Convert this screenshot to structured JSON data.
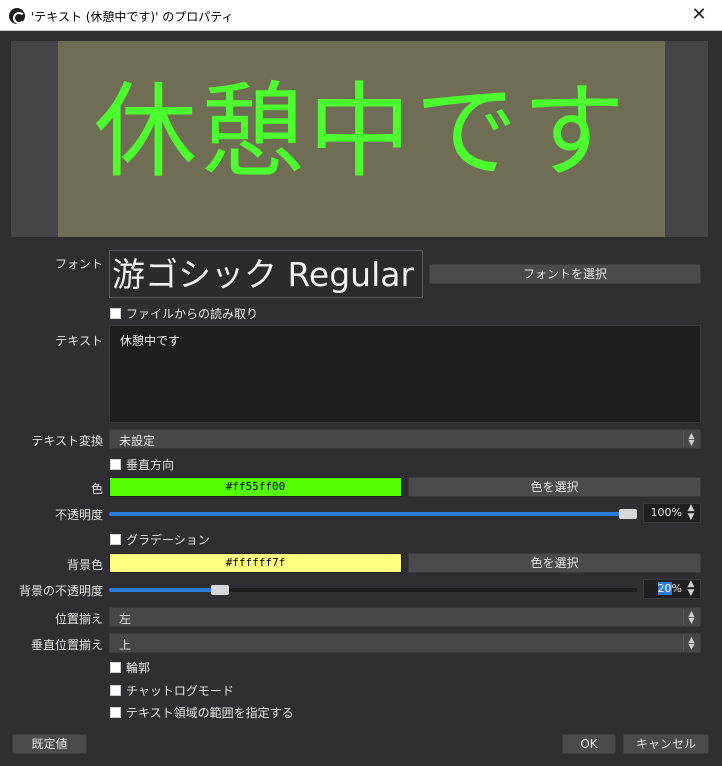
{
  "window": {
    "title": "'テキスト (休憩中です)' のプロパティ",
    "icon": "obs-logo-icon",
    "close_icon": "close-icon"
  },
  "preview": {
    "text": "休憩中です",
    "text_color": "#4cff2e",
    "background_color": "#6f6e54"
  },
  "form": {
    "font": {
      "label": "フォント",
      "value": "游ゴシック Regular",
      "button": "フォントを選択"
    },
    "read_from_file": {
      "label": "ファイルからの読み取り",
      "checked": false
    },
    "text": {
      "label": "テキスト",
      "value": "休憩中です"
    },
    "transform": {
      "label": "テキスト変換",
      "value": "未設定"
    },
    "vertical": {
      "label": "垂直方向",
      "checked": false
    },
    "color": {
      "label": "色",
      "value": "#ff55ff00",
      "swatch_color": "#55ff00",
      "button": "色を選択"
    },
    "opacity": {
      "label": "不透明度",
      "value": "100%",
      "level": 1.0
    },
    "gradient": {
      "label": "グラデーション",
      "checked": false
    },
    "bg_color": {
      "label": "背景色",
      "value": "#ffffff7f",
      "swatch_color": "#ffff7f",
      "button": "色を選択"
    },
    "bg_opacity": {
      "label": "背景の不透明度",
      "value_selected": "20",
      "value_suffix": "%",
      "level": 0.2
    },
    "align": {
      "label": "位置揃え",
      "value": "左"
    },
    "valign": {
      "label": "垂直位置揃え",
      "value": "上"
    },
    "outline": {
      "label": "輪郭",
      "checked": false
    },
    "chatlog": {
      "label": "チャットログモード",
      "checked": false
    },
    "extents": {
      "label": "テキスト領域の範囲を指定する",
      "checked": false
    }
  },
  "footer": {
    "defaults": "既定値",
    "ok": "OK",
    "cancel": "キャンセル"
  },
  "colors": {
    "dialog_bg": "#2f2f33",
    "accent": "#2b7de0"
  }
}
